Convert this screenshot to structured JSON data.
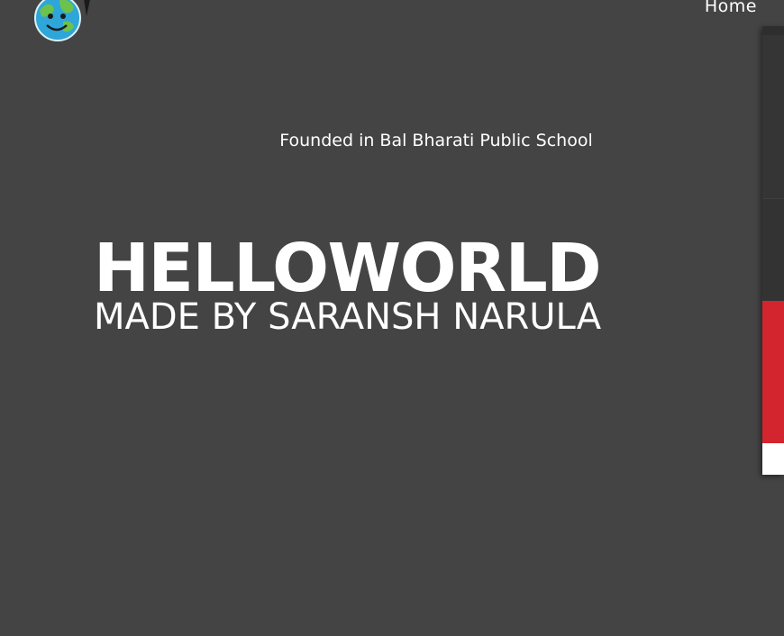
{
  "header": {
    "nav_home": "Home"
  },
  "hero": {
    "tagline": "Founded in Bal Bharati Public School",
    "title": "HELLOWORLD",
    "subtitle": "MADE BY SARANSH NARULA"
  },
  "colors": {
    "background": "#444444",
    "text": "#ffffff",
    "accent_red": "#d3252e"
  },
  "icons": {
    "logo": "smiling-globe-logo"
  }
}
